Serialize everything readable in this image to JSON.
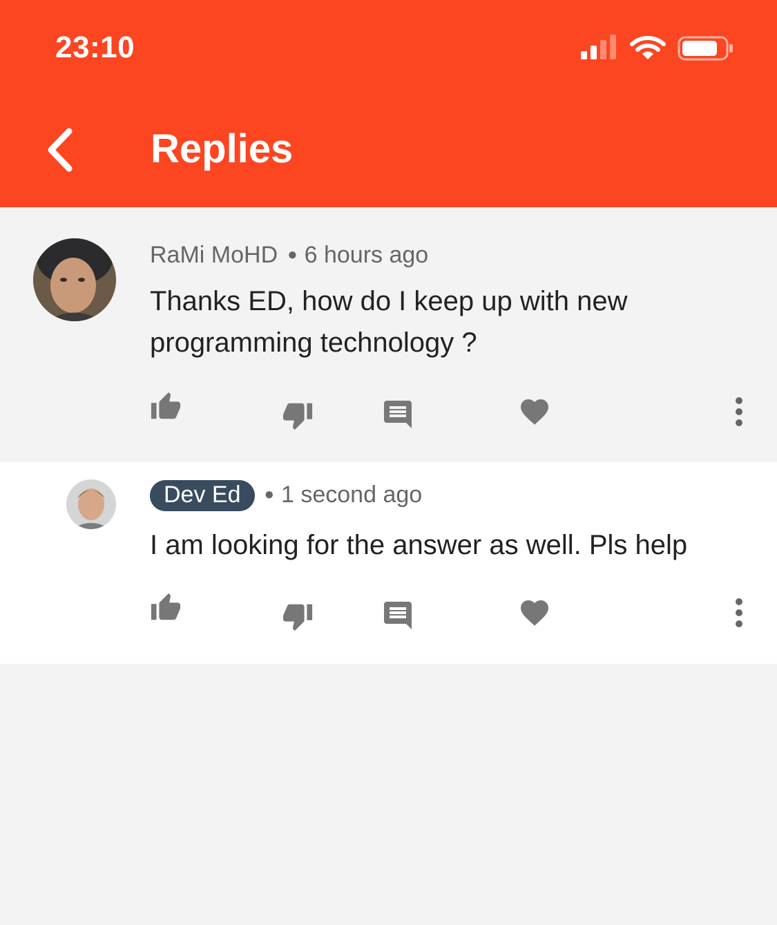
{
  "status_bar": {
    "time": "23:10"
  },
  "header": {
    "title": "Replies",
    "back_icon": "chevron-left-icon",
    "color": "#fc4521"
  },
  "comments": [
    {
      "author": "RaMi MoHD",
      "time_ago": "6 hours ago",
      "text": "Thanks ED, how do I keep up with new programming technology ?",
      "author_is_badge": false
    },
    {
      "author": "Dev Ed",
      "time_ago": "1 second ago",
      "text": "I am looking for the answer as well. Pls help",
      "author_is_badge": true,
      "badge_color": "#394b5f"
    }
  ],
  "action_icons": [
    "thumb-up-icon",
    "thumb-down-icon",
    "reply-comment-icon",
    "heart-icon",
    "more-vertical-icon"
  ]
}
